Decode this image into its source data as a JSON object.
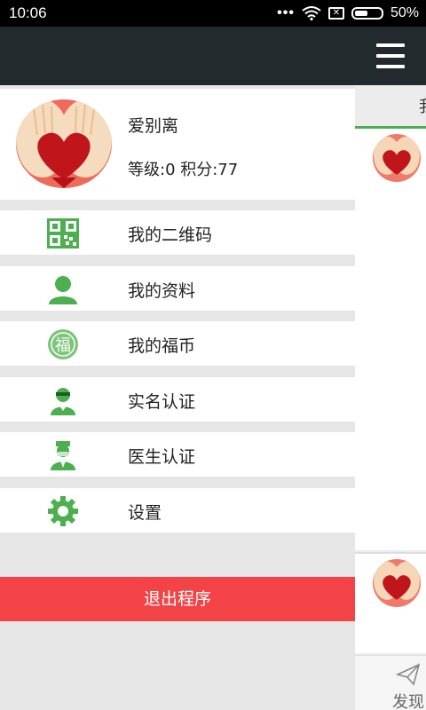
{
  "status_bar": {
    "time": "10:06",
    "battery": "50%"
  },
  "profile": {
    "name": "爱别离",
    "level_points": "等级:0 积分:77"
  },
  "menu": [
    {
      "label": "我的二维码",
      "icon": "qr-code-icon"
    },
    {
      "label": "我的资料",
      "icon": "user-icon"
    },
    {
      "label": "我的福币",
      "icon": "fu-coin-icon"
    },
    {
      "label": "实名认证",
      "icon": "real-name-verify-icon"
    },
    {
      "label": "医生认证",
      "icon": "doctor-verify-icon"
    },
    {
      "label": "设置",
      "icon": "gear-icon"
    }
  ],
  "logout_label": "退出程序",
  "main": {
    "tab_partial": "我",
    "bottom_nav_label": "发现"
  },
  "colors": {
    "accent_green": "#4caf50",
    "logout_red": "#f44347",
    "header_dark": "#222a2d"
  }
}
